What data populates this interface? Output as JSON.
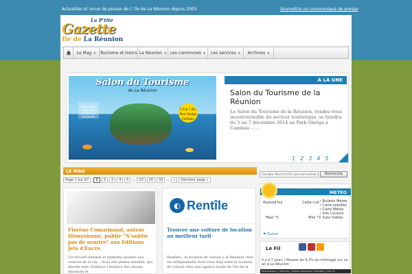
{
  "topbar": {
    "tagline": "Actualités et revue de presse de L' île de La Réunion depuis 2003",
    "submit_link": "Soumettre un communiqué de presse"
  },
  "logo": {
    "small": "La P'tite",
    "big": "Gazette",
    "sub_left": "Ile de",
    "sub_right": "La Réunion"
  },
  "nav": {
    "items": [
      "Le Mag",
      "Tourisme et loisirs",
      "La Réunion",
      "Les communes",
      "Les services",
      "Archives"
    ]
  },
  "slider": {
    "label": "A LA UNE",
    "image_title": "Salon du Tourisme",
    "image_subtitle": "de La Réunion",
    "image_badge": "5, 6 & 7 déc. Park Oméga Cambaie",
    "image_note": "Bons plans pour vos prochaines vacances",
    "title": "Salon du Tourisme de la Réunion",
    "text": "Le Salon du Tourisme de la Réunion, rendez-vous incontournable du secteur touristique, se tiendra du 5 au 7 décembre 2014 au Park Oméga à Cambaie – ...",
    "pages": [
      "1",
      "2",
      "3",
      "4",
      "5"
    ]
  },
  "mag": {
    "label": "LE MAG",
    "page_info": "Page 1 sur 67",
    "pages": [
      "1",
      "2",
      "3",
      "4",
      "5",
      "...",
      "10",
      "20",
      "30",
      "...",
      "»"
    ],
    "last_page": "Dernière page »"
  },
  "cards": [
    {
      "title": "Florène Comarmond, auteur Dionysienne, publie \"N'oublie pas de sourire\" aux Editions Jets d'Encre.",
      "text": "Un recueil sensible et intimiste puisées aux sources de la vie… Sous une plume sensible, qui aborde avec évidence l'essence des choses, émotions et"
    },
    {
      "logo_word": "Rentîle",
      "title": "Trouver une voiture de location au meilleur tarif",
      "text": "Rentîles : la location de voiture à la Réunion chez les indépendants Avez-vous déjà testé la location de voiture chez une agence locale de l'île de la"
    }
  ],
  "search": {
    "placeholder": "Google Recherche personnalisée",
    "button": "Recherche"
  },
  "meteo": {
    "label": "METEO",
    "today": "Aujourd'hui",
    "tonight": "Cette nuit",
    "max": "Maxi °C",
    "min": "Mini °C",
    "links": [
      "Bulletin Météo",
      "Carte satellite",
      "Carte Météo",
      "Info Cyclone",
      "Suivi météo"
    ],
    "social": "Suivre"
  },
  "fil": {
    "title": "Le Fil",
    "text": "Il y a 7 jours | Hausse de 9,3% du chômage sur un an à La Réunion",
    "footer": "Informations | Services | Petites Annonces Gratuites | Info Ch"
  }
}
